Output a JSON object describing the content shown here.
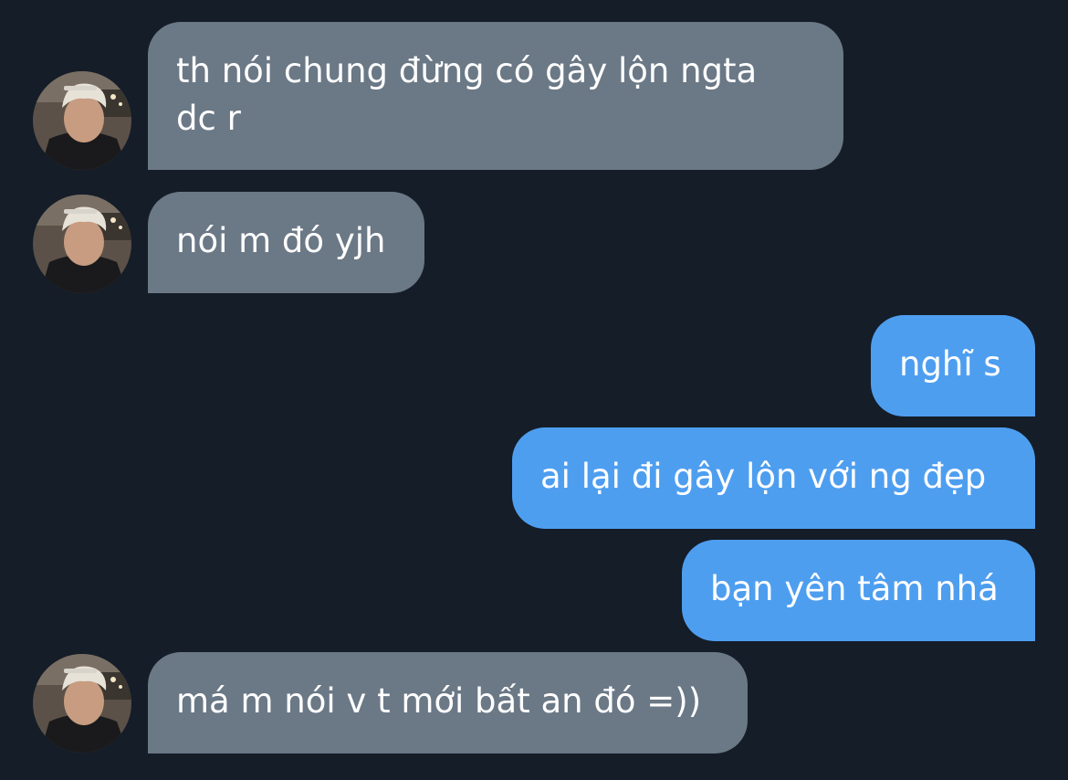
{
  "conversation": {
    "messages": [
      {
        "sender": "contact",
        "text": "th nói chung đừng có gây lộn ngta\ndc r"
      },
      {
        "sender": "contact",
        "text": "nói m đó yjh"
      },
      {
        "sender": "me",
        "text": "nghĩ s"
      },
      {
        "sender": "me",
        "text": "ai lại đi gây lộn với ng đẹp"
      },
      {
        "sender": "me",
        "text": "bạn yên tâm nhá"
      },
      {
        "sender": "contact",
        "text": "má m nói v t mới bất an đó =))"
      }
    ]
  },
  "colors": {
    "background": "#151d28",
    "incoming_bubble": "#6b7886",
    "outgoing_bubble": "#4e9ef0",
    "text": "#ffffff"
  }
}
